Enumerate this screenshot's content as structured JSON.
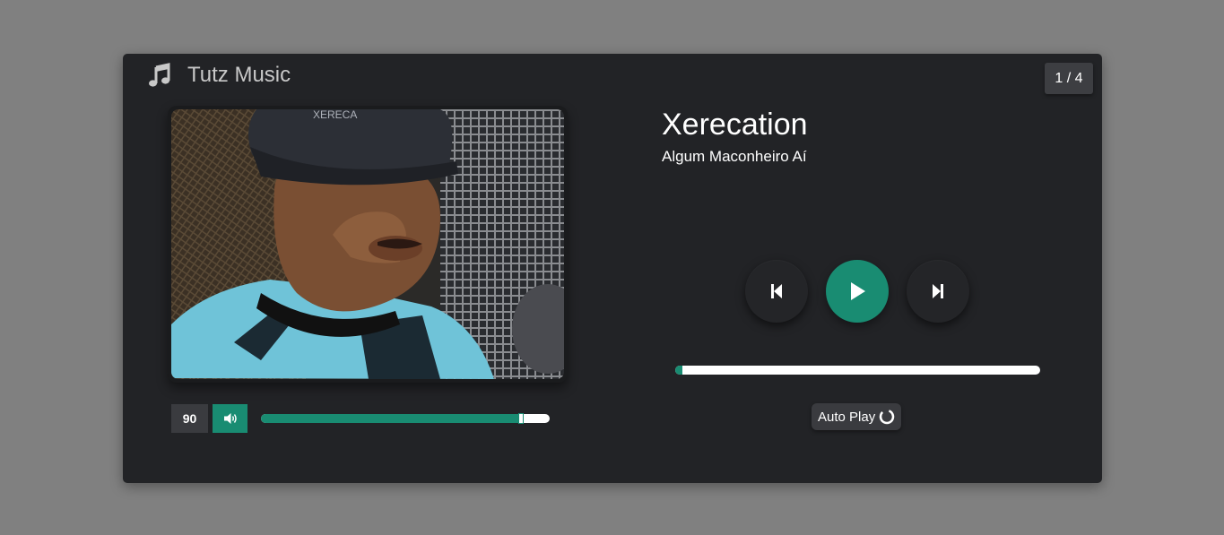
{
  "app": {
    "title": "Tutz Music"
  },
  "counter": {
    "text": "1 / 4"
  },
  "song": {
    "title": "Xerecation",
    "artist": "Algum Maconheiro Aí"
  },
  "volume": {
    "value": "90",
    "level_percent": 90
  },
  "progress": {
    "percent": 2
  },
  "controls": {
    "previous_icon": "skip-previous-icon",
    "play_icon": "play-icon",
    "next_icon": "skip-next-icon"
  },
  "autoplay": {
    "label": "Auto Play",
    "icon": "loading-spinner-icon"
  },
  "colors": {
    "accent": "#198c72",
    "panel": "#222326",
    "background": "#808080"
  }
}
